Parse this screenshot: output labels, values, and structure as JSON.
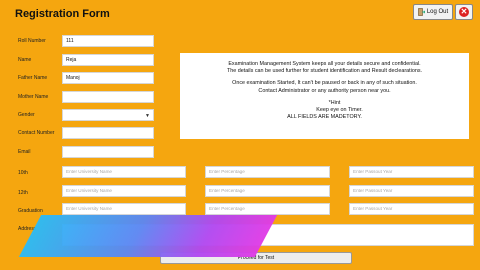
{
  "header": {
    "title": "Registration Form",
    "logout_label": "Log Out"
  },
  "form": {
    "fields": [
      {
        "label": "Roll Number",
        "value": "111"
      },
      {
        "label": "Name",
        "value": "Reja"
      },
      {
        "label": "Father Name",
        "value": "Manoj"
      },
      {
        "label": "Mother Name",
        "value": ""
      },
      {
        "label": "Gender",
        "value": ""
      },
      {
        "label": "Contact Number",
        "value": ""
      },
      {
        "label": "Email",
        "value": ""
      }
    ],
    "education_rows": [
      {
        "label": "10th",
        "placeholders": [
          "Enter University Name",
          "Enter Percentage",
          "Enter Passout Year"
        ]
      },
      {
        "label": "12th",
        "placeholders": [
          "Enter University Name",
          "Enter Percentage",
          "Enter Passout Year"
        ]
      },
      {
        "label": "Graduation",
        "placeholders": [
          "Enter University Name",
          "Enter Percentage",
          "Enter Passout Year"
        ]
      }
    ],
    "address_label": "Address"
  },
  "info": {
    "line1": "Examination Management System keeps all your details secure and confidential.",
    "line2": "The details can be used further for student identification and Result declearations.",
    "line3": "Once examination Started, It can't be paused or back in any of such situation.",
    "line4": "Contact Administrator or any authority person near you.",
    "hint": "*Hint",
    "keep": "Keep eye on Timer.",
    "all_fields": "ALL FIELDS ARE MADETORY."
  },
  "proceed_label": "Proceed for Test",
  "colors": {
    "background": "#F5A60F",
    "close_icon": "#DD2222",
    "stripe_start": "#2BBBF6",
    "stripe_end": "#E03BE6"
  }
}
